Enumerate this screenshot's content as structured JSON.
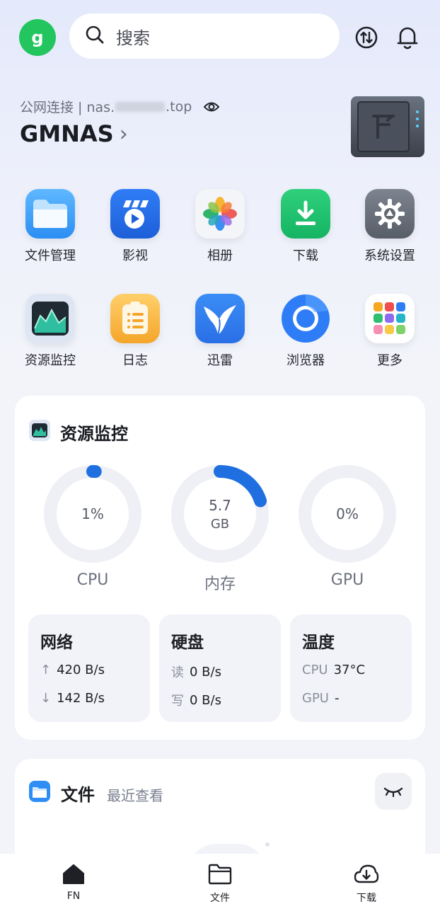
{
  "header": {
    "avatar_letter": "g",
    "search_placeholder": "搜索"
  },
  "nas": {
    "connection_prefix": "公网连接 | nas.",
    "connection_suffix": ".top",
    "name": "GMNAS",
    "chevron": "›"
  },
  "apps": [
    {
      "label": "文件管理",
      "icon": "folder-icon"
    },
    {
      "label": "影视",
      "icon": "video-icon"
    },
    {
      "label": "相册",
      "icon": "photos-icon"
    },
    {
      "label": "下载",
      "icon": "download-icon"
    },
    {
      "label": "系统设置",
      "icon": "gear-icon"
    },
    {
      "label": "资源监控",
      "icon": "monitor-icon"
    },
    {
      "label": "日志",
      "icon": "log-icon"
    },
    {
      "label": "迅雷",
      "icon": "xunlei-icon"
    },
    {
      "label": "浏览器",
      "icon": "browser-icon"
    },
    {
      "label": "更多",
      "icon": "more-apps-icon"
    }
  ],
  "monitor": {
    "title": "资源监控",
    "cpu": {
      "value": "1%",
      "label": "CPU",
      "fraction": 0.01
    },
    "memory": {
      "value": "5.7",
      "unit": "GB",
      "label": "内存",
      "fraction": 0.2
    },
    "gpu": {
      "value": "0%",
      "label": "GPU",
      "fraction": 0
    },
    "network": {
      "title": "网络",
      "up": "420 B/s",
      "down": "142 B/s"
    },
    "disk": {
      "title": "硬盘",
      "read_key": "读",
      "read": "0 B/s",
      "write_key": "写",
      "write": "0 B/s"
    },
    "temp": {
      "title": "温度",
      "cpu_key": "CPU",
      "cpu": "37°C",
      "gpu_key": "GPU",
      "gpu": "-"
    }
  },
  "files": {
    "title": "文件",
    "subtitle": "最近查看"
  },
  "bottom_nav": [
    {
      "label": "FN",
      "icon": "home-icon"
    },
    {
      "label": "文件",
      "icon": "folder-outline-icon"
    },
    {
      "label": "下载",
      "icon": "download-cloud-icon"
    }
  ],
  "colors": {
    "accent": "#1f6fe0",
    "avatar": "#22c55e",
    "ring_track": "#eef0f5"
  }
}
